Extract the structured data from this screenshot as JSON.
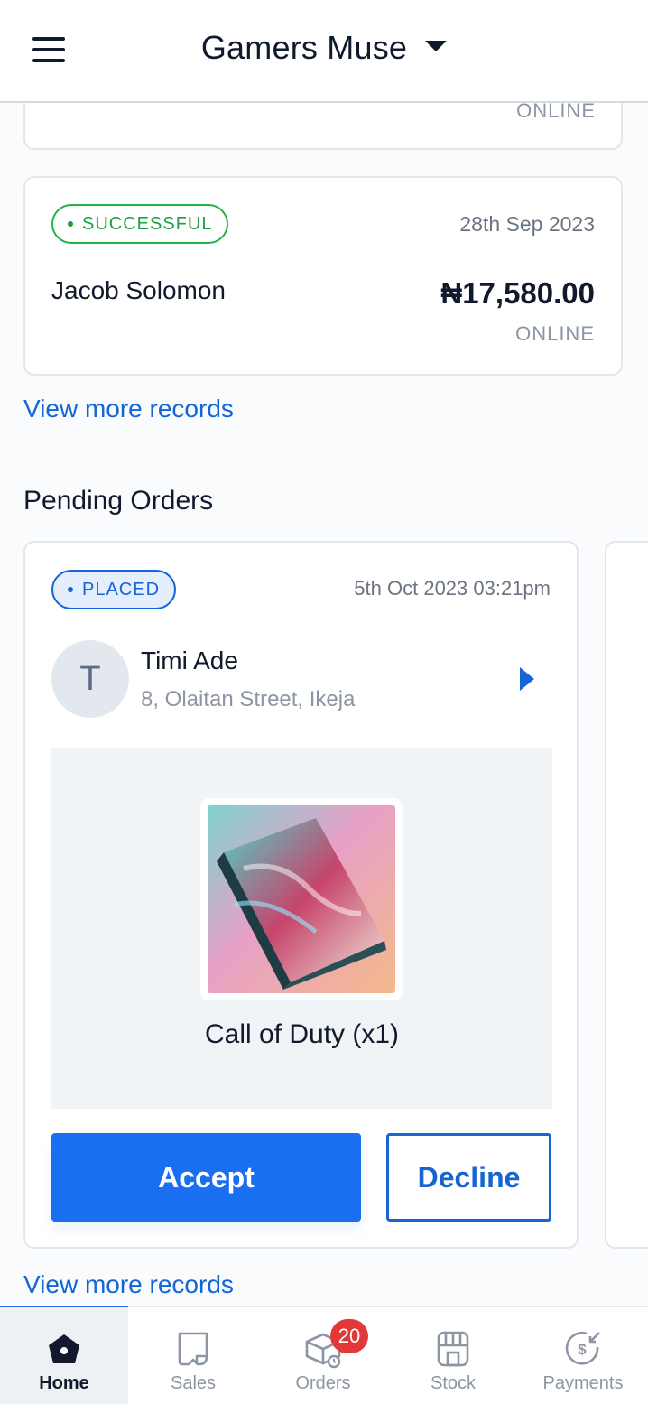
{
  "header": {
    "store_name": "Gamers Muse"
  },
  "recent_sales": {
    "partial_card": {
      "channel": "ONLINE"
    },
    "sale": {
      "status": "SUCCESSFUL",
      "date": "28th Sep 2023",
      "customer": "Jacob Solomon",
      "amount": "₦17,580.00",
      "channel": "ONLINE"
    },
    "view_more": "View more records"
  },
  "pending_orders": {
    "title": "Pending Orders",
    "order": {
      "status": "PLACED",
      "date": "5th Oct 2023 03:21pm",
      "avatar_initial": "T",
      "customer": "Timi Ade",
      "address": "8, Olaitan Street, Ikeja",
      "item": "Call of Duty (x1)",
      "accept_label": "Accept",
      "decline_label": "Decline"
    },
    "view_more": "View more records"
  },
  "bottom_nav": {
    "items": [
      {
        "label": "Home",
        "icon": "home-icon",
        "active": true
      },
      {
        "label": "Sales",
        "icon": "receipt-icon",
        "active": false
      },
      {
        "label": "Orders",
        "icon": "box-icon",
        "active": false
      },
      {
        "label": "Stock",
        "icon": "store-icon",
        "active": false
      },
      {
        "label": "Payments",
        "icon": "payment-icon",
        "active": false
      }
    ],
    "orders_badge": "20"
  },
  "colors": {
    "primary": "#1a6ef0",
    "success": "#1f9e3f",
    "badge_red": "#e23838",
    "text_dark": "#101a2c",
    "text_muted": "#8c96a3"
  }
}
